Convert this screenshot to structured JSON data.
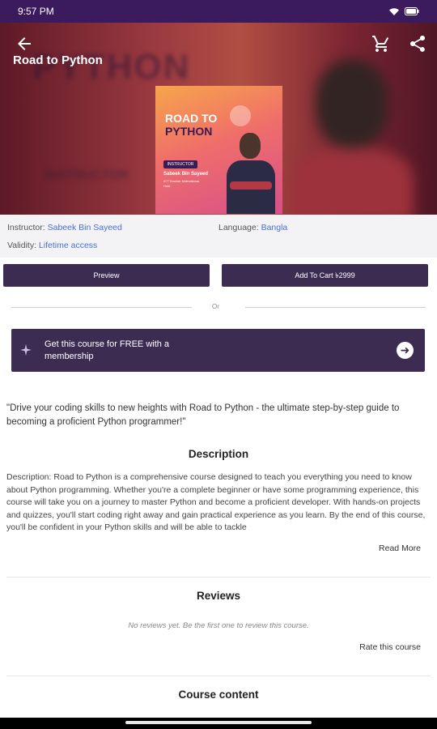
{
  "status_bar": {
    "time": "9:57 PM",
    "battery_icon": "battery-icon",
    "wifi_icon": "wifi-icon"
  },
  "header": {
    "title": "Road to Python",
    "back_icon": "arrow-left-icon",
    "cart_icon": "cart-icon",
    "share_icon": "share-icon"
  },
  "hero": {
    "thumbnail": {
      "title_line1": "ROAD TO",
      "title_line2": "PYTHON",
      "tag": "INSTRUCTOR",
      "instructor_name": "Sabeek Bin Sayeed",
      "instructor_role": "ICT Teacher Motivational Host"
    }
  },
  "info": {
    "instructor_label": "Instructor:",
    "instructor_value": "Sabeek Bin Sayeed",
    "language_label": "Language:",
    "language_value": "Bangla",
    "validity_label": "Validity:",
    "validity_value": "Lifetime access"
  },
  "actions": {
    "preview_label": "Preview",
    "add_to_cart_label": "Add To Cart ৳2999",
    "or_text": "Or"
  },
  "membership": {
    "text": "Get this course for FREE with a membership",
    "spark_icon": "sparkle-icon",
    "arrow_icon": "arrow-right-circle-icon"
  },
  "tagline": "\"Drive your coding skills to new heights with Road to Python - the ultimate step-by-step guide to becoming a proficient Python programmer!\"",
  "description": {
    "title": "Description",
    "body": "Description: Road to Python is a comprehensive course designed to teach you everything you need to know about Python programming. Whether you're a complete beginner or have some programming experience, this course will take you on a journey to master Python and become a proficient developer. With hands-on projects and quizzes, you'll start coding right away and gain practical experience as you learn. By the end of this course, you'll be confident in your Python skills and will be able to tackle",
    "read_more": "Read More"
  },
  "reviews": {
    "title": "Reviews",
    "empty_text": "No reviews yet. Be the first one to review this course.",
    "rate_label": "Rate this course"
  },
  "course_content": {
    "title": "Course content"
  },
  "colors": {
    "status_bar": "#3c1a5e",
    "primary_button": "#3d2c52",
    "link": "#4a6fd1",
    "info_background": "#f3f3f5"
  }
}
